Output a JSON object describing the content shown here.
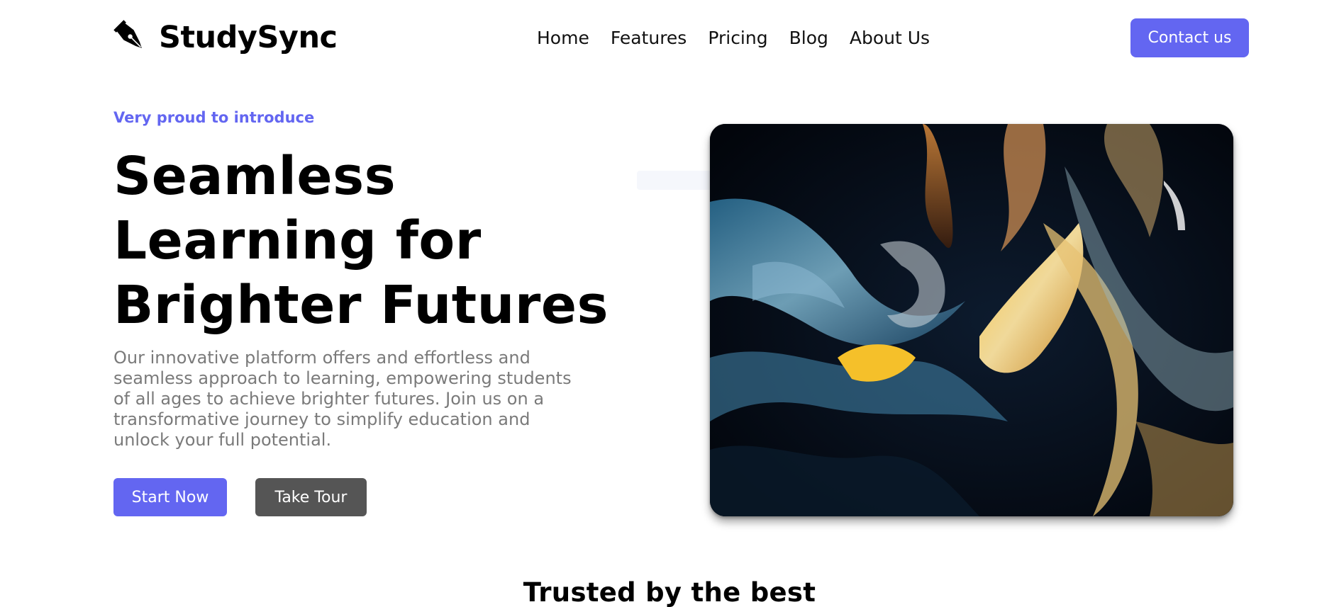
{
  "header": {
    "brand": "StudySync",
    "nav": [
      "Home",
      "Features",
      "Pricing",
      "Blog",
      "About Us"
    ],
    "contact_label": "Contact us"
  },
  "hero": {
    "eyebrow": "Very proud to introduce",
    "headline": [
      "Seamless",
      "Learning for",
      "Brighter Futures"
    ],
    "description": "Our innovative platform offers and effortless and seamless approach to learning, empowering students of all ages to achieve brighter futures. Join us on a transformative journey to simplify education and unlock your full potential.",
    "primary_cta": "Start Now",
    "secondary_cta": "Take Tour",
    "image": "abstract-fluid-art-image"
  },
  "trusted": {
    "title": "Trusted by the best"
  },
  "colors": {
    "accent": "#6366f1",
    "secondary_button": "#555555",
    "body_text_muted": "#7a7a7a"
  }
}
